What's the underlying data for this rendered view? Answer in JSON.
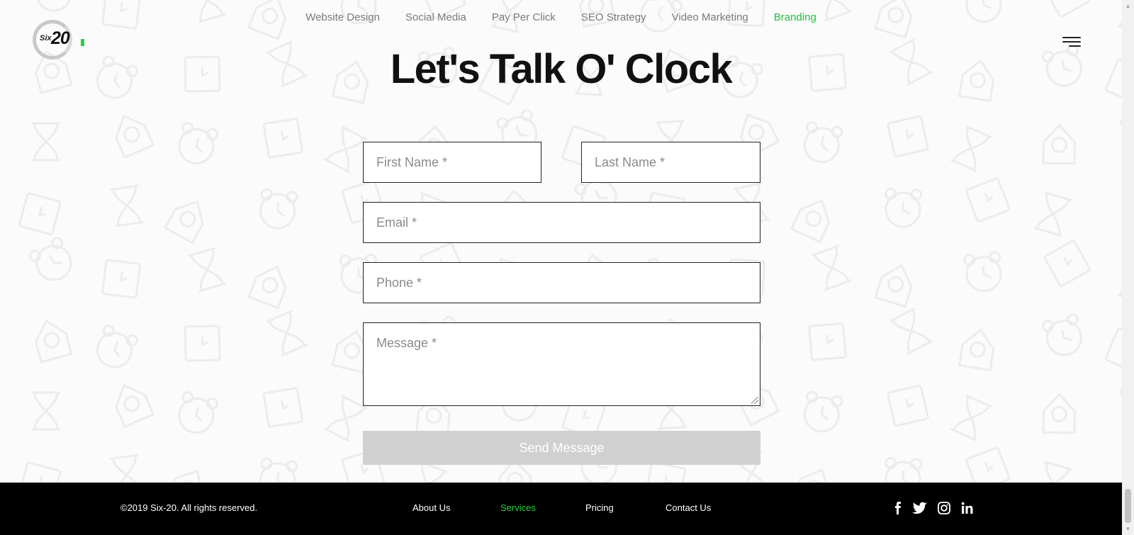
{
  "brand": {
    "logo_prefix": "Six",
    "logo_number": "20",
    "accent_color": "#1fc23c"
  },
  "topnav": {
    "items": [
      {
        "label": "Website Design",
        "active": false
      },
      {
        "label": "Social Media",
        "active": false
      },
      {
        "label": "Pay Per Click",
        "active": false
      },
      {
        "label": "SEO Strategy",
        "active": false
      },
      {
        "label": "Video Marketing",
        "active": false
      },
      {
        "label": "Branding",
        "active": true
      }
    ]
  },
  "menu": {
    "icon": "hamburger-menu-icon"
  },
  "page": {
    "title": "Let's Talk O' Clock",
    "background_pattern": "clock-doodle-pattern"
  },
  "form": {
    "first_name": {
      "placeholder": "First Name *",
      "value": ""
    },
    "last_name": {
      "placeholder": "Last Name *",
      "value": ""
    },
    "email": {
      "placeholder": "Email *",
      "value": ""
    },
    "phone": {
      "placeholder": "Phone *",
      "value": ""
    },
    "message": {
      "placeholder": "Message *",
      "value": ""
    },
    "submit_label": "Send Message",
    "submit_color": "#d0d0d0"
  },
  "footer": {
    "copyright": "©2019 Six-20. All rights reserved.",
    "links": [
      {
        "label": "About Us",
        "active": false
      },
      {
        "label": "Services",
        "active": true
      },
      {
        "label": "Pricing",
        "active": false
      },
      {
        "label": "Contact Us",
        "active": false
      }
    ],
    "social": [
      "facebook-icon",
      "twitter-icon",
      "instagram-icon",
      "linkedin-icon"
    ]
  }
}
